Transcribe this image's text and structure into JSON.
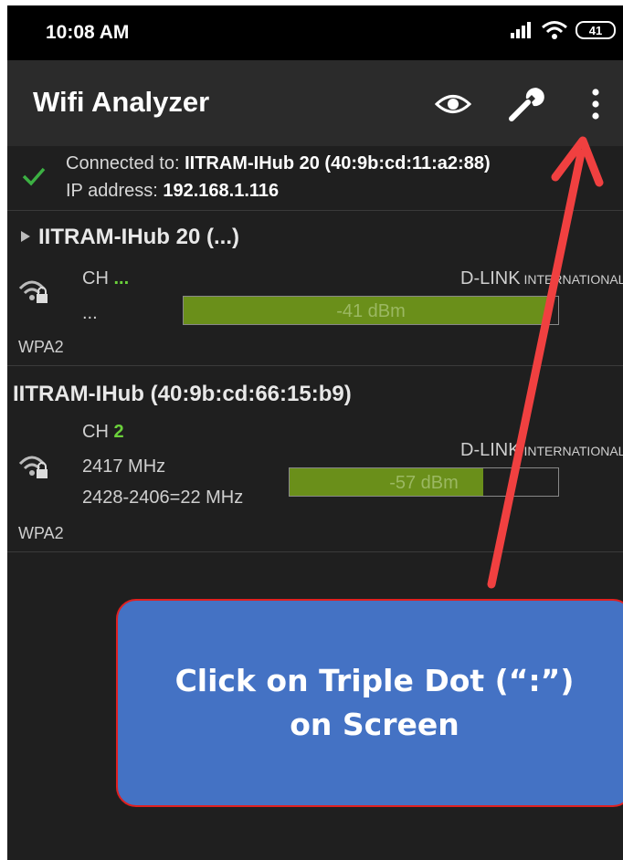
{
  "status_bar": {
    "time": "10:08 AM",
    "battery": "41"
  },
  "app_bar": {
    "title": "Wifi Analyzer"
  },
  "connection": {
    "connected_label": "Connected to: ",
    "connected_value": "IITRAM-IHub 20 (40:9b:cd:11:a2:88)",
    "ip_label": "IP address: ",
    "ip_value": "192.168.1.116"
  },
  "networks": [
    {
      "title": "IITRAM-IHub 20 (...)",
      "ch_label": "CH",
      "channel": "...",
      "detail": "...",
      "vendor_main": "D-LINK",
      "vendor_tail": " INTERNATIONAL",
      "signal": "-41 dBm",
      "signal_fraction": 0.97,
      "security": "WPA2"
    },
    {
      "title": "IITRAM-IHub (40:9b:cd:66:15:b9)",
      "ch_label": "CH",
      "channel": "2",
      "frequency": "2417 MHz",
      "width": "2428-2406=22 MHz",
      "vendor_main": "D-LINK",
      "vendor_tail": " INTERNATIONAL",
      "signal": "-57 dBm",
      "signal_fraction": 0.72,
      "security": "WPA2"
    }
  ],
  "callout": {
    "line1": "Click on Triple Dot (“:”)",
    "line2": "on Screen"
  },
  "colors": {
    "accent_green": "#6bd13b",
    "signal_bar": "#6a8f1a",
    "callout_fill": "#4472c4",
    "arrow": "#f04040"
  }
}
